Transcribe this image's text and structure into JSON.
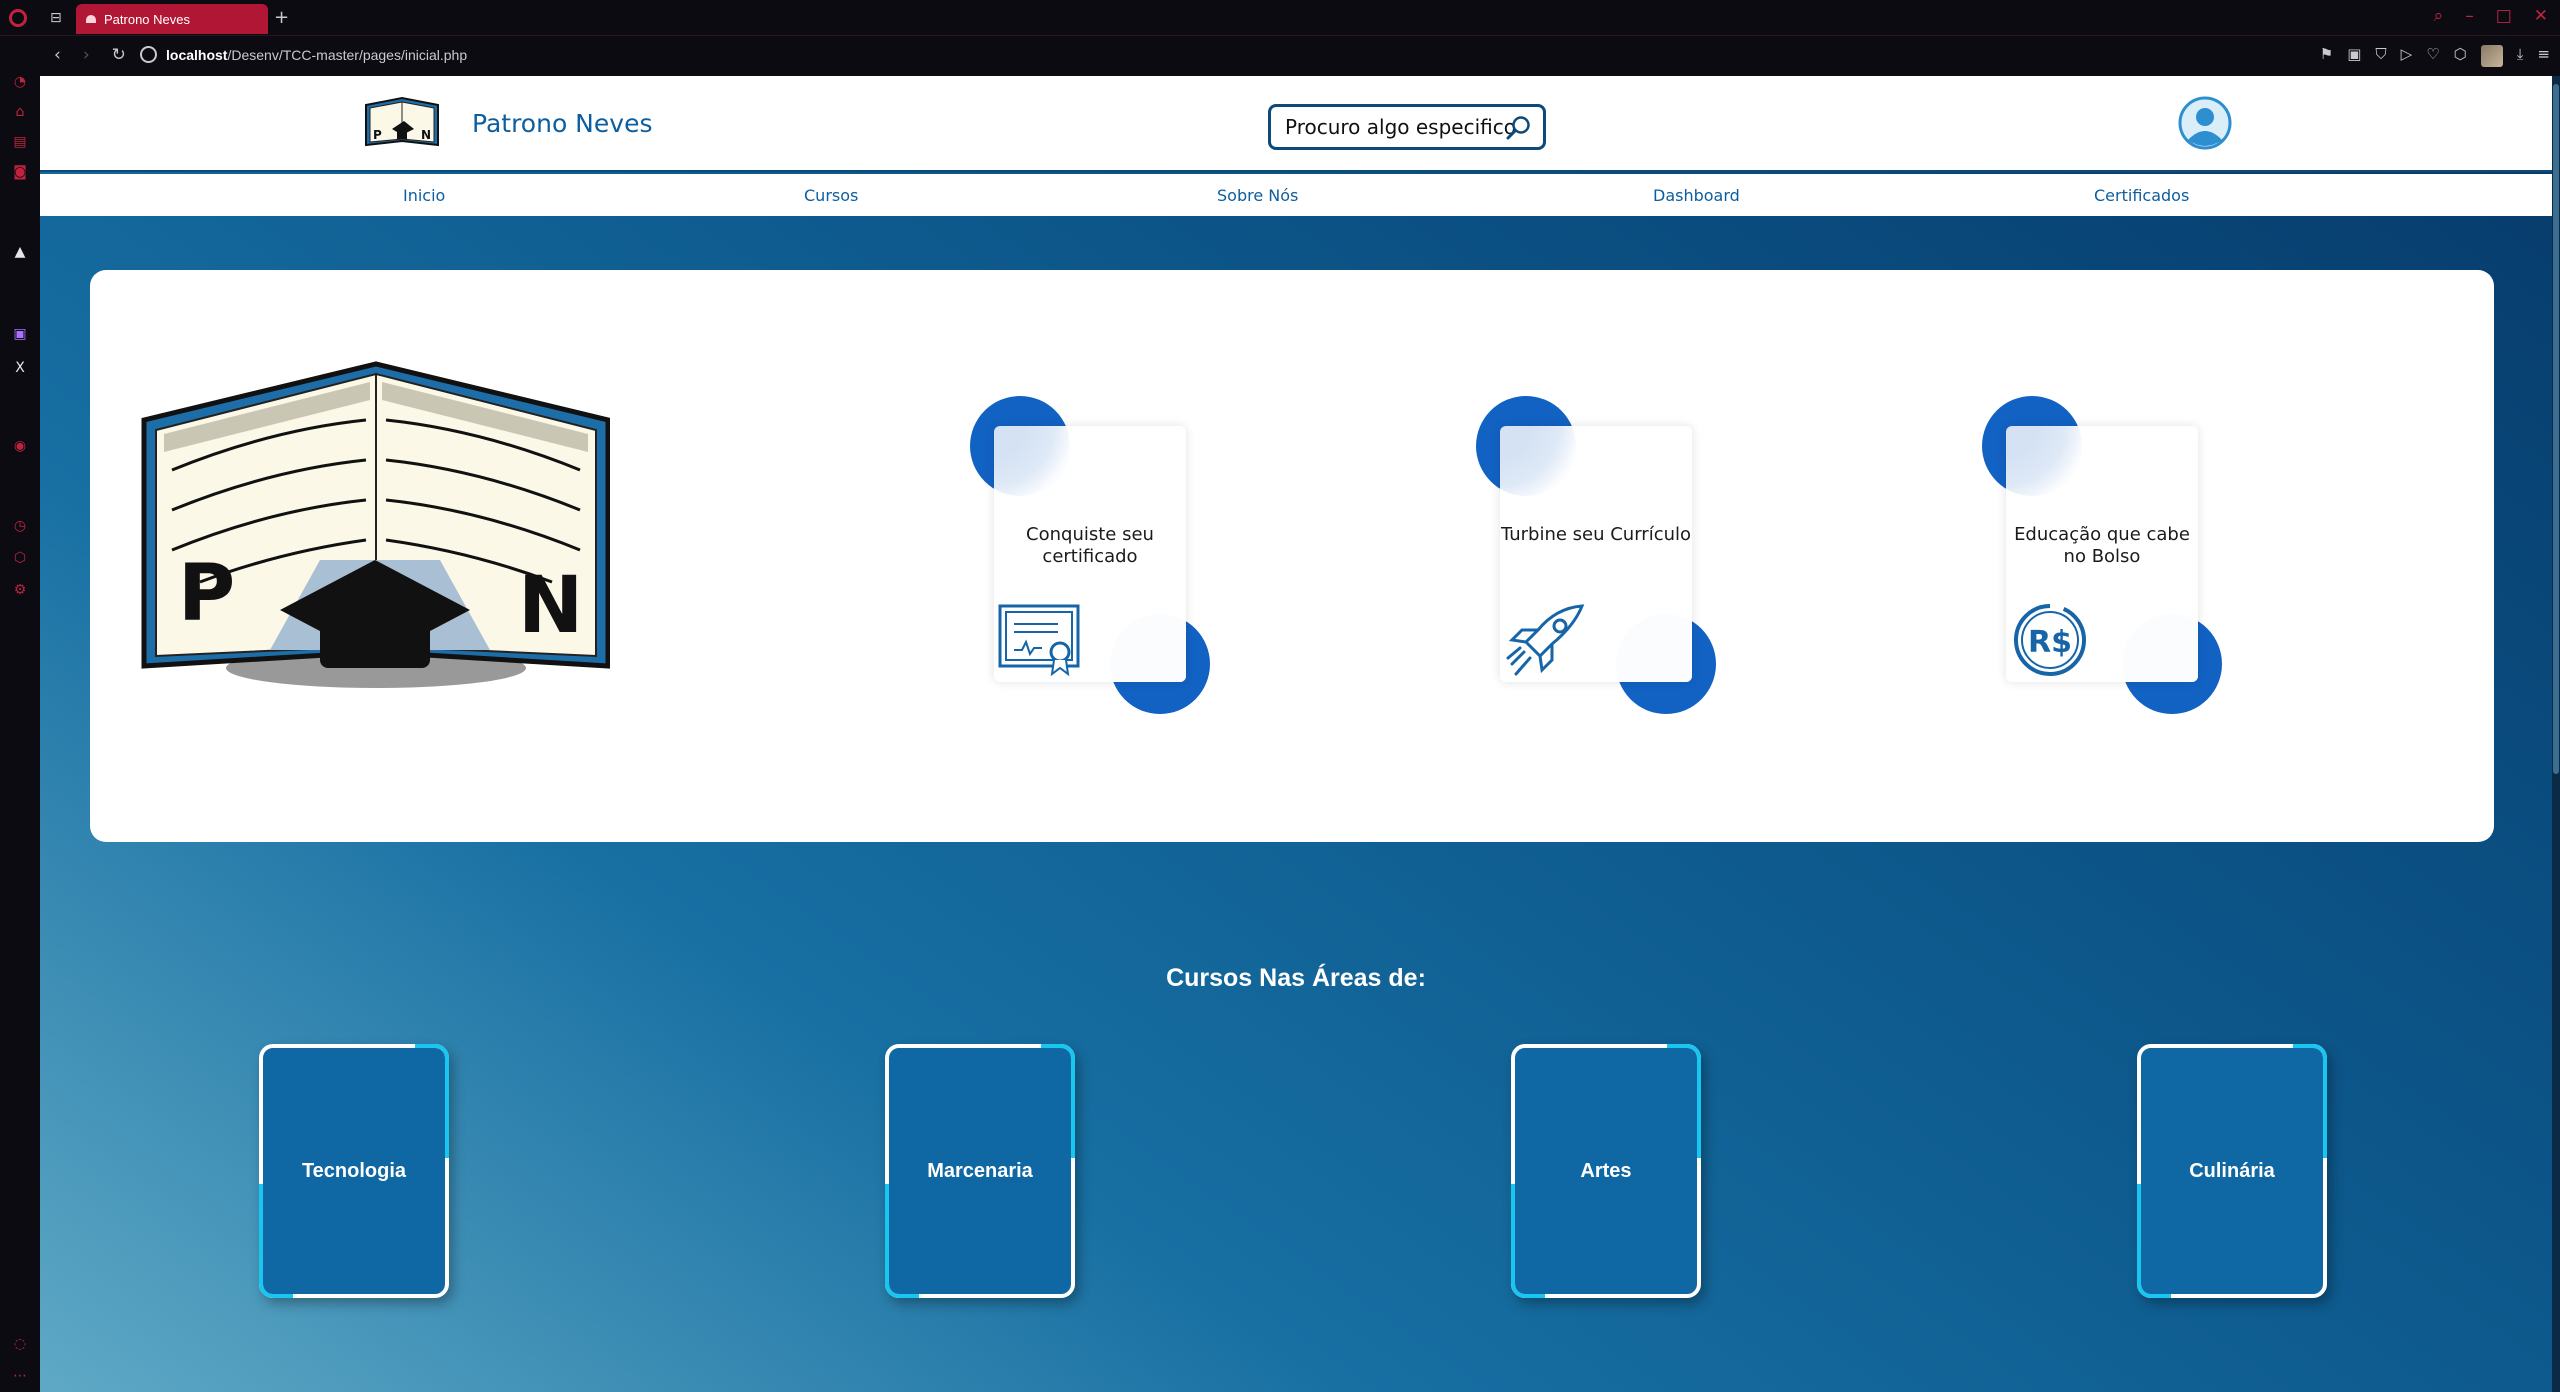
{
  "browser": {
    "tab_title": "Patrono Neves",
    "url_host": "localhost",
    "url_path": "/Desenv/TCC-master/pages/inicial.php"
  },
  "header": {
    "brand_name": "Patrono Neves",
    "search_label": "Procuro algo especifico",
    "logo_letters": [
      "P",
      "N"
    ]
  },
  "nav": {
    "items": [
      "Inicio",
      "Cursos",
      "Sobre Nós",
      "Dashboard",
      "Certificados"
    ]
  },
  "hero": {
    "features": [
      {
        "title": "Conquiste seu certificado",
        "icon": "certificate-icon"
      },
      {
        "title": "Turbine seu Currículo",
        "icon": "rocket-icon"
      },
      {
        "title": "Educação que cabe no Bolso",
        "icon": "money-icon",
        "icon_text": "R$"
      }
    ]
  },
  "areas": {
    "title": "Cursos Nas Áreas de:",
    "items": [
      "Tecnologia",
      "Marcenaria",
      "Artes",
      "Culinária"
    ]
  },
  "colors": {
    "brand_blue": "#0d5e9e",
    "accent_blob": "#1262c4",
    "card_accent": "#19c6f0",
    "browser_accent": "#b11735"
  }
}
